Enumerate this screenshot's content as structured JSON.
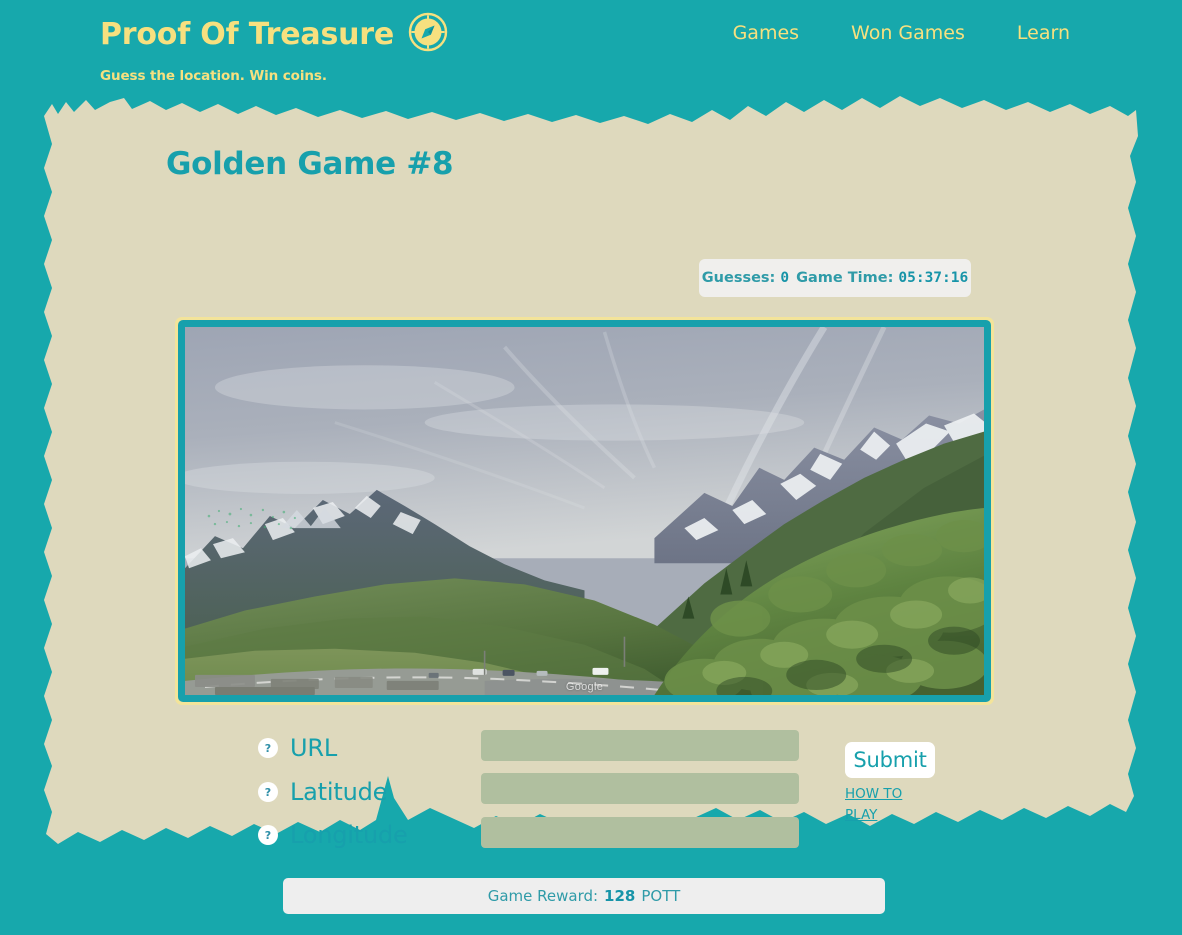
{
  "colors": {
    "teal_bg": "#17a8ac",
    "paper": "#ded9bd",
    "accent_yellow": "#f7e07f",
    "teal_text": "#17a0ac",
    "input_green": "#b0bf9f"
  },
  "header": {
    "brand_title": "Proof Of Treasure",
    "tagline": "Guess the location. Win coins.",
    "logo_icon": "compass-icon",
    "nav": [
      {
        "label": "Games"
      },
      {
        "label": "Won Games"
      },
      {
        "label": "Learn"
      }
    ]
  },
  "main": {
    "game_title": "Golden Game #8",
    "stats": {
      "guesses_label": "Guesses:",
      "guesses_value": "0",
      "time_label": "Game Time:",
      "time_value": "05:37:16"
    },
    "streetview": {
      "watermark": "Google",
      "alt": "Alpine mountain pass with snow-capped peaks, green hillside and a winding road"
    },
    "form": {
      "help_icon_glyph": "?",
      "fields": [
        {
          "label": "URL",
          "value": "",
          "placeholder": ""
        },
        {
          "label": "Latitude",
          "value": "",
          "placeholder": ""
        },
        {
          "label": "Longitude",
          "value": "",
          "placeholder": ""
        }
      ],
      "submit_label": "Submit",
      "howto_label": "HOW TO PLAY"
    }
  },
  "footer": {
    "reward_label": "Game Reward:",
    "reward_amount": "128",
    "reward_unit": "POTT"
  }
}
